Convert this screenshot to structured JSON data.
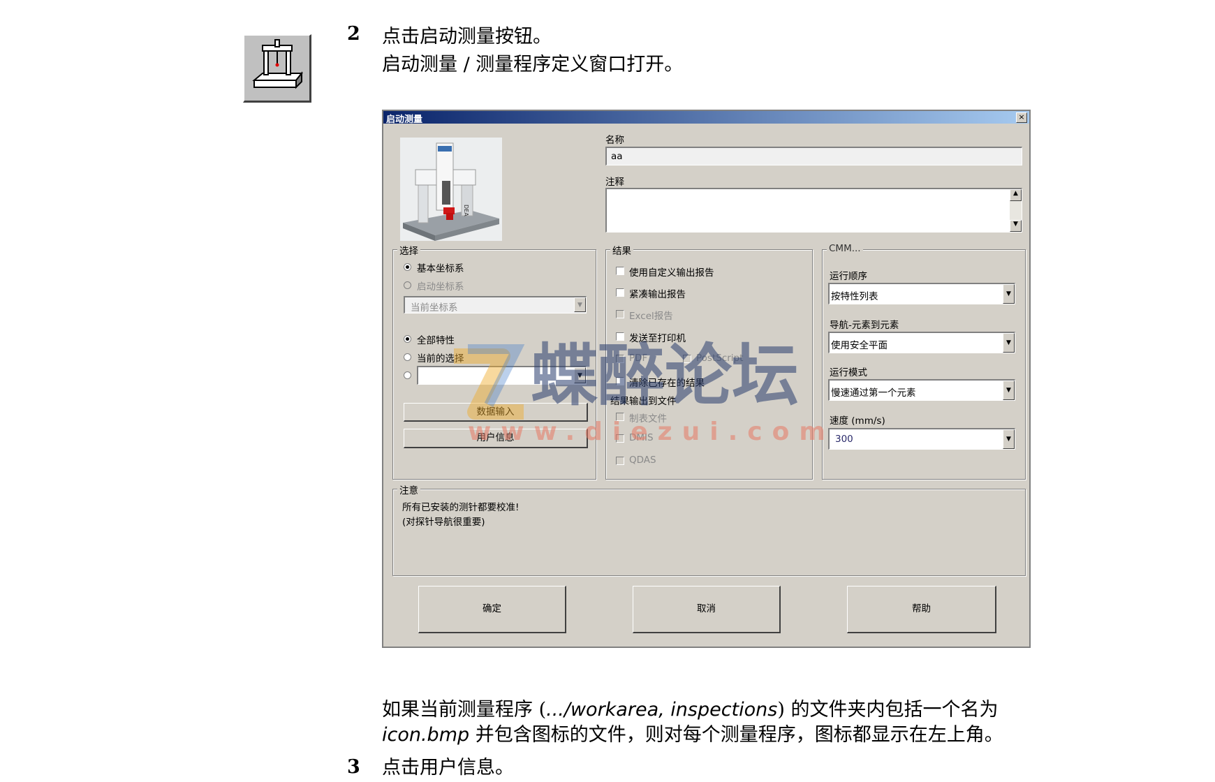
{
  "step2": {
    "number": "2",
    "line1_prefix": "点击",
    "line1_strong": "启动测量",
    "line1_suffix": "按钮。",
    "line2_strong": "启动测量 / 测量程序定义",
    "line2_suffix": "窗口打开。"
  },
  "dialog": {
    "title": "启动测量",
    "close": "×",
    "name_label": "名称",
    "name_value": "aa",
    "comment_label": "注释",
    "selection": {
      "legend": "选择",
      "radio_base": "基本坐标系",
      "radio_start": "启动坐标系",
      "coord_select": "当前坐标系",
      "radio_all": "全部特性",
      "radio_current": "当前的选择",
      "data_input_button": "数据输入",
      "user_info_button": "用户信息"
    },
    "results": {
      "legend": "结果",
      "use_custom_report": "使用自定义输出报告",
      "compact_report": "紧凑输出报告",
      "excel_report": "Excel报告",
      "send_to_printer": "发送至打印机",
      "pdf": "PDF",
      "postscript": "PostScript",
      "clear_existing": "清除已存在的结果",
      "output_to_file": "结果输出到文件",
      "table_file": "制表文件",
      "dmis": "DMIS",
      "qdas": "QDAS"
    },
    "cmm": {
      "legend": "CMM...",
      "run_order_label": "运行顺序",
      "run_order_value": "按特性列表",
      "nav_label": "导航-元素到元素",
      "nav_value": "使用安全平面",
      "run_mode_label": "运行模式",
      "run_mode_value": "慢速通过第一个元素",
      "speed_label": "速度 (mm/s)",
      "speed_value": "300"
    },
    "note": {
      "legend": "注意",
      "line1": "所有已安装的测针都要校准!",
      "line2": "(对探针导航很重要)"
    },
    "ok_button": "确定",
    "cancel_button": "取消",
    "help_button": "帮助"
  },
  "watermark": {
    "cn": "蝶醉论坛",
    "url": "www.diezui.com"
  },
  "paragraph": {
    "part1": "如果当前测量程序 (",
    "path": ".../workarea, inspections",
    "part2": ") 的文件夹内包括一个名为",
    "file": "icon.bmp",
    "part3": " 并包含图标的文件，则对每个测量程序，图标都显示在左上角。"
  },
  "step3": {
    "number": "3",
    "prefix": "点击",
    "strong": "用户信息",
    "suffix": "。"
  }
}
